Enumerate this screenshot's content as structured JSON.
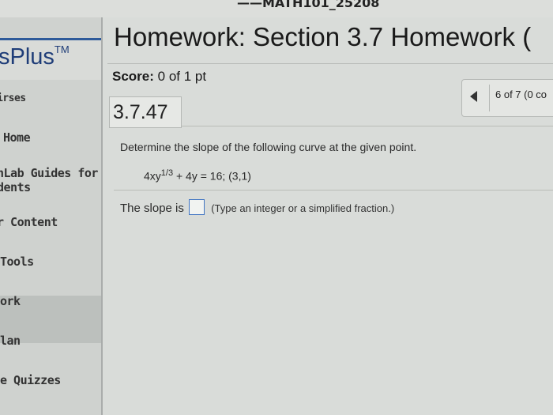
{
  "header": {
    "course_code": "——MATH101_25208"
  },
  "sidebar": {
    "brand": "sPlus",
    "brand_tm": "TM",
    "items": [
      {
        "label": "irses"
      },
      {
        "label": "Home"
      },
      {
        "label_line1": "hLab Guides for",
        "label_line2": "dents"
      },
      {
        "label": "r Content"
      },
      {
        "label": "Tools"
      },
      {
        "label": "ork"
      },
      {
        "label": "lan"
      },
      {
        "label": "e Quizzes"
      }
    ]
  },
  "main": {
    "title": "Homework: Section 3.7 Homework (",
    "score_label": "Score:",
    "score_value": " 0 of 1 pt",
    "nav_text": "6 of 7 (0 co",
    "question_number": "3.7.47",
    "prompt": "Determine the slope of the following curve at the given point.",
    "equation_pre": "4xy",
    "equation_exp": "1/3",
    "equation_post": " + 4y = 16; (3,1)",
    "answer_prefix": "The slope is",
    "answer_value": "",
    "answer_hint": "(Type an integer or a simplified fraction.)"
  }
}
